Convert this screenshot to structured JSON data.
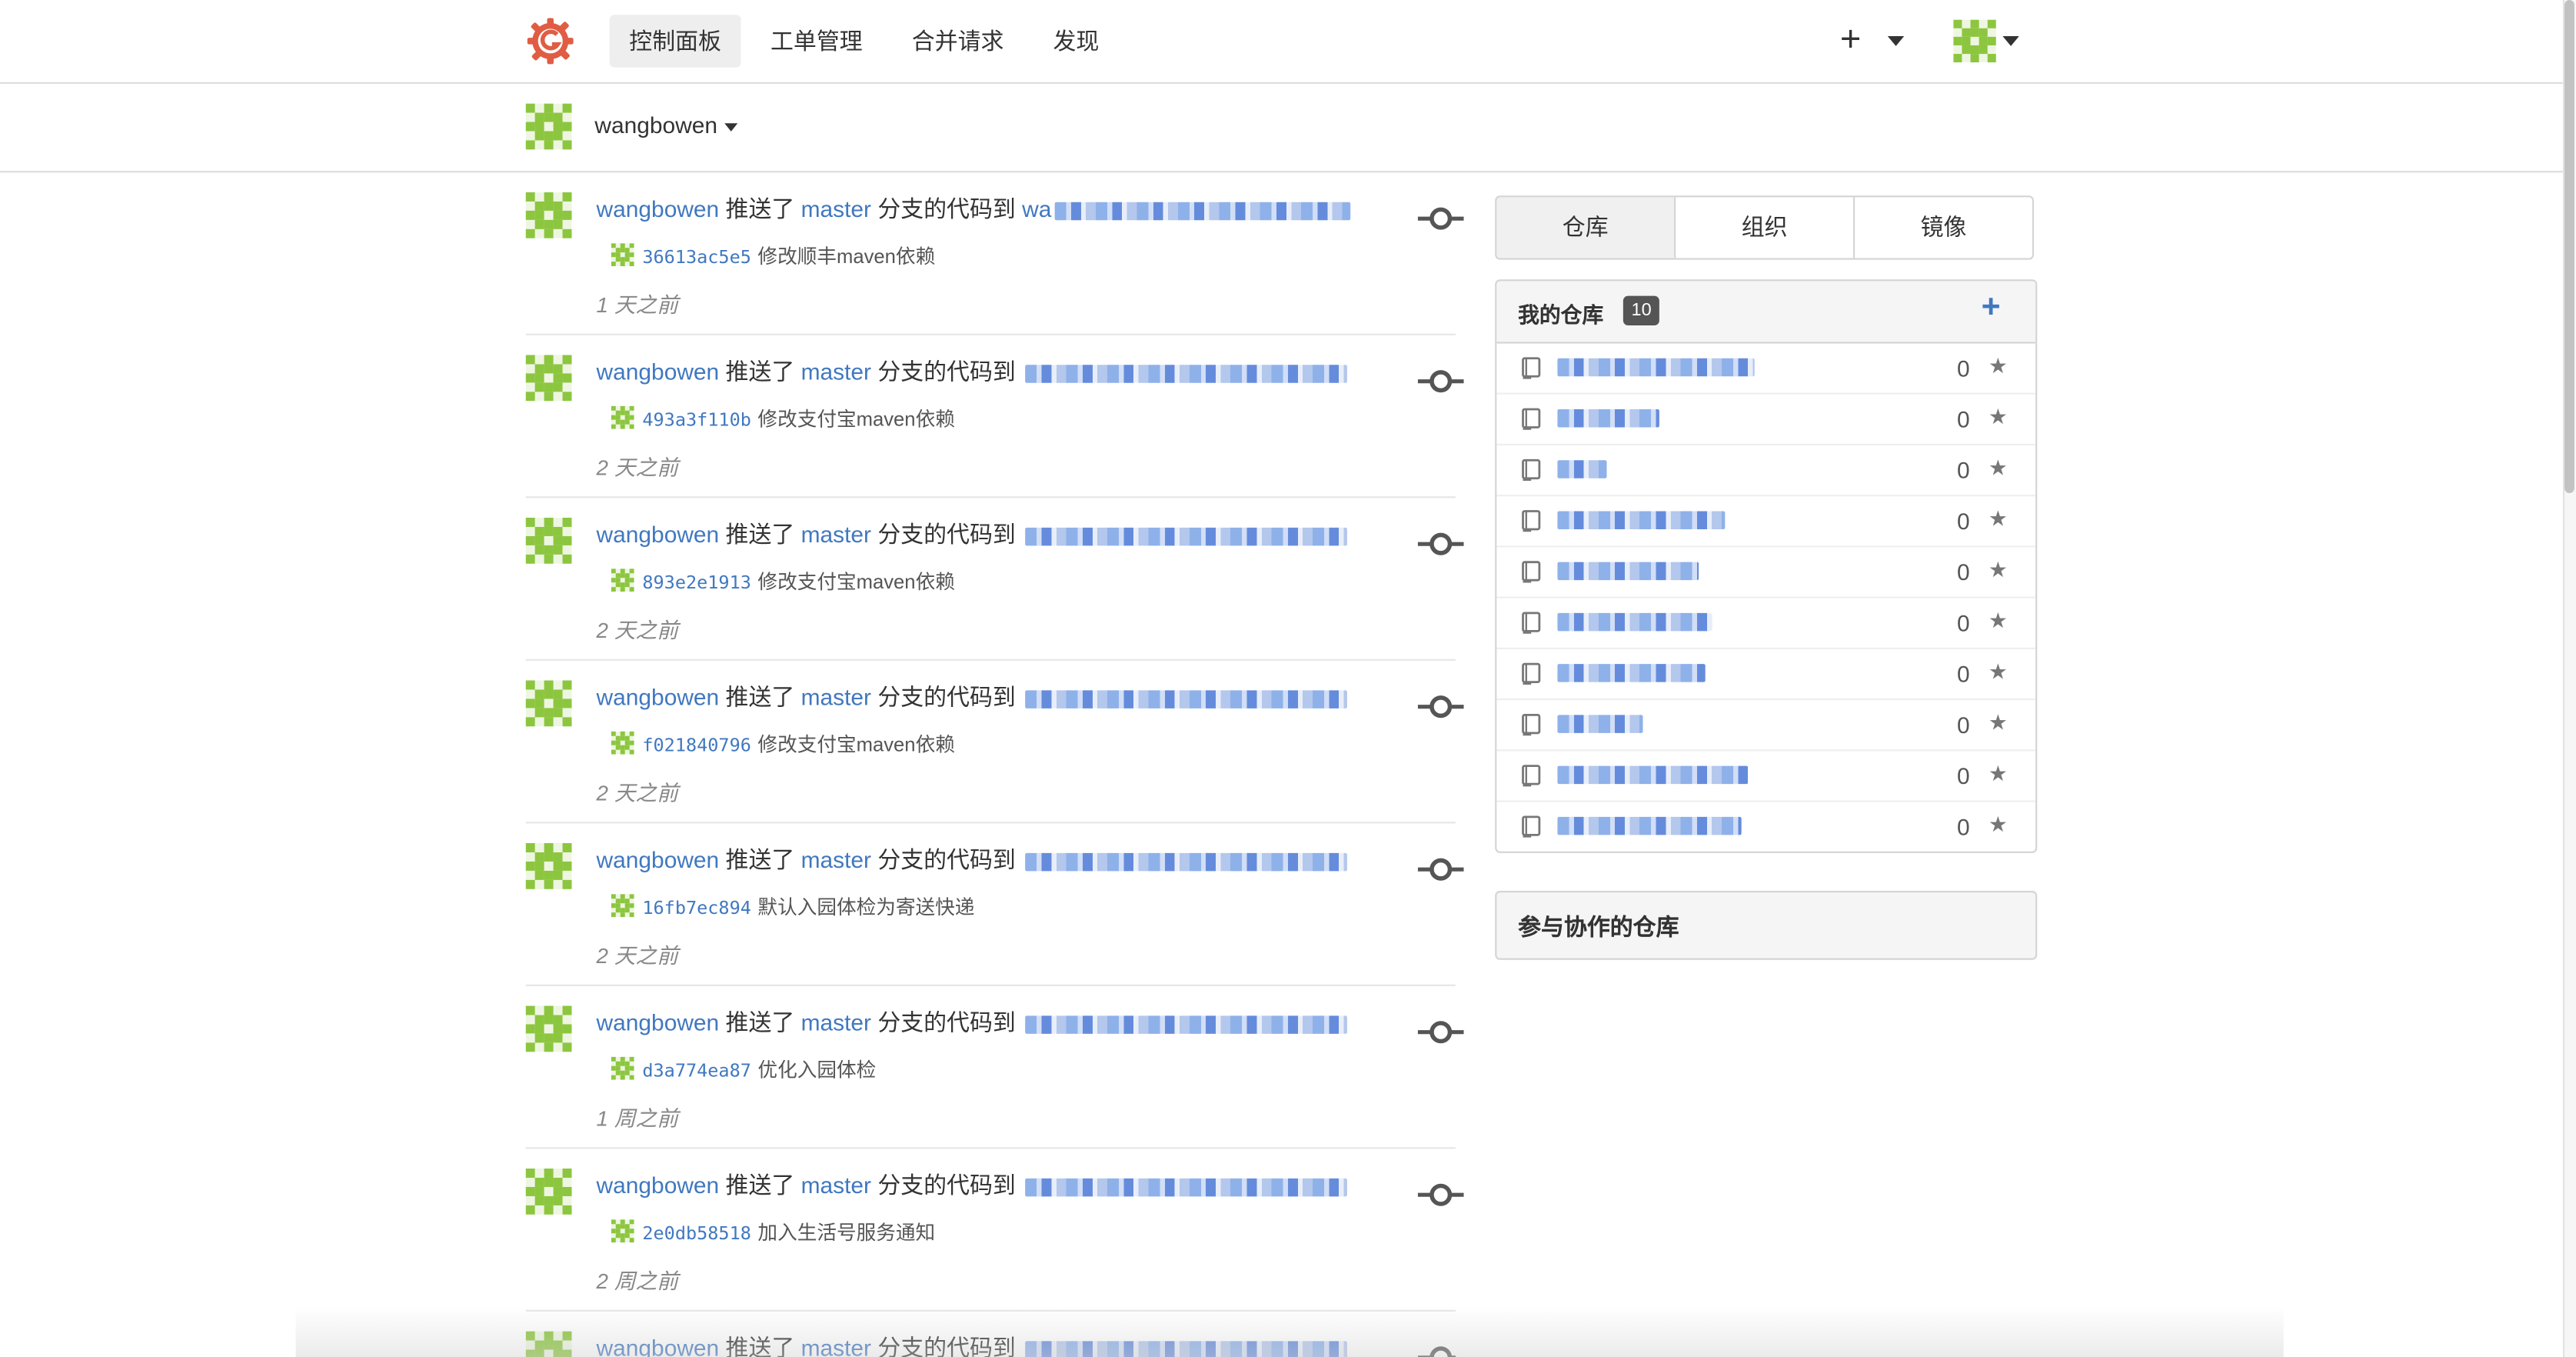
{
  "nav": {
    "items": [
      {
        "label": "控制面板",
        "active": true
      },
      {
        "label": "工单管理",
        "active": false
      },
      {
        "label": "合并请求",
        "active": false
      },
      {
        "label": "发现",
        "active": false
      }
    ],
    "plus_symbol": "+"
  },
  "context": {
    "username": "wangbowen"
  },
  "feed": {
    "items": [
      {
        "user": "wangbowen",
        "action": "推送了",
        "branch": "master",
        "suffix": "分支的代码到",
        "repo_prefix": "wa",
        "sha": "36613ac5e5",
        "message": "修改顺丰maven依赖",
        "time": "1 天之前"
      },
      {
        "user": "wangbowen",
        "action": "推送了",
        "branch": "master",
        "suffix": "分支的代码到",
        "repo_prefix": "",
        "sha": "493a3f110b",
        "message": "修改支付宝maven依赖",
        "time": "2 天之前"
      },
      {
        "user": "wangbowen",
        "action": "推送了",
        "branch": "master",
        "suffix": "分支的代码到",
        "repo_prefix": "",
        "sha": "893e2e1913",
        "message": "修改支付宝maven依赖",
        "time": "2 天之前"
      },
      {
        "user": "wangbowen",
        "action": "推送了",
        "branch": "master",
        "suffix": "分支的代码到",
        "repo_prefix": "",
        "sha": "f021840796",
        "message": "修改支付宝maven依赖",
        "time": "2 天之前"
      },
      {
        "user": "wangbowen",
        "action": "推送了",
        "branch": "master",
        "suffix": "分支的代码到",
        "repo_prefix": "",
        "sha": "16fb7ec894",
        "message": "默认入园体检为寄送快递",
        "time": "2 天之前"
      },
      {
        "user": "wangbowen",
        "action": "推送了",
        "branch": "master",
        "suffix": "分支的代码到",
        "repo_prefix": "",
        "sha": "d3a774ea87",
        "message": "优化入园体检",
        "time": "1 周之前"
      },
      {
        "user": "wangbowen",
        "action": "推送了",
        "branch": "master",
        "suffix": "分支的代码到",
        "repo_prefix": "",
        "sha": "2e0db58518",
        "message": "加入生活号服务通知",
        "time": "2 周之前"
      },
      {
        "user": "wangbowen",
        "action": "推送了",
        "branch": "master",
        "suffix": "分支的代码到",
        "repo_prefix": "",
        "sha": "",
        "message": "",
        "time": ""
      }
    ]
  },
  "sidebar": {
    "tabs": [
      {
        "label": "仓库",
        "active": true
      },
      {
        "label": "组织",
        "active": false
      },
      {
        "label": "镜像",
        "active": false
      }
    ],
    "my_repos": {
      "title": "我的仓库",
      "count": "10",
      "add_symbol": "+",
      "rows": [
        {
          "stars": "0"
        },
        {
          "stars": "0"
        },
        {
          "stars": "0"
        },
        {
          "stars": "0"
        },
        {
          "stars": "0"
        },
        {
          "stars": "0"
        },
        {
          "stars": "0"
        },
        {
          "stars": "0"
        },
        {
          "stars": "0"
        },
        {
          "stars": "0"
        }
      ]
    },
    "collab": {
      "title": "参与协作的仓库"
    }
  },
  "icons": {
    "logo": "gogs-gear-logo",
    "avatar": "identicon-avatar",
    "commit": "git-commit-icon",
    "repo": "book-repo-icon",
    "star": "star-icon"
  },
  "colors": {
    "link": "#4078c0",
    "logo": "#e05d44",
    "identicon": "#8cc63f"
  }
}
